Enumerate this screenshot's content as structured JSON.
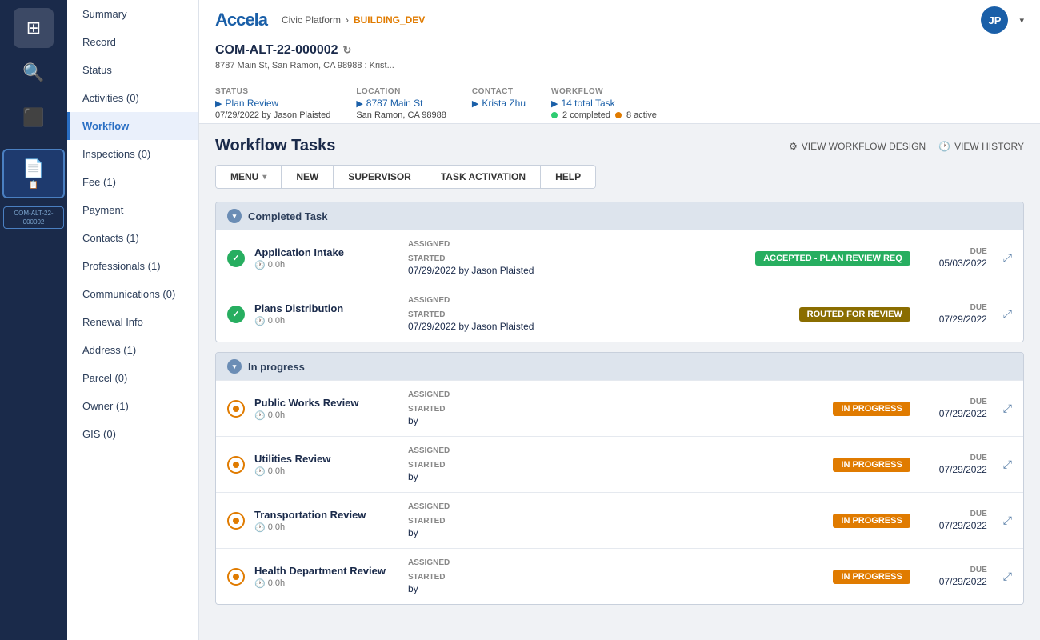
{
  "app": {
    "logo": "Accela",
    "breadcrumb": {
      "platform": "Civic Platform",
      "separator": "›",
      "env": "BUILDING_DEV"
    },
    "avatar": "JP",
    "chevron": "▾"
  },
  "record": {
    "id": "COM-ALT-22-000002",
    "address": "8787 Main St, San Ramon, CA 98988 : Krist...",
    "refresh_icon": "↻"
  },
  "meta_fields": [
    {
      "label": "STATUS",
      "value": "Plan Review",
      "sub": "07/29/2022 by Jason Plaisted",
      "has_arrow": true
    },
    {
      "label": "LOCATION",
      "value": "8787 Main St",
      "sub": "San Ramon, CA 98988",
      "has_arrow": true
    },
    {
      "label": "CONTACT",
      "value": "Krista Zhu",
      "sub": "",
      "has_arrow": true
    },
    {
      "label": "WORKFLOW",
      "value": "14 total Task",
      "sub_green": "2 completed",
      "sub_orange": "8 active",
      "has_arrow": true
    }
  ],
  "sidebar": {
    "items": [
      {
        "label": "Summary",
        "count": "",
        "active": false
      },
      {
        "label": "Record",
        "count": "",
        "active": false
      },
      {
        "label": "Status",
        "count": "",
        "active": false
      },
      {
        "label": "Activities",
        "count": "(0)",
        "active": false
      },
      {
        "label": "Workflow",
        "count": "",
        "active": true
      },
      {
        "label": "Inspections",
        "count": "(0)",
        "active": false
      },
      {
        "label": "Fee",
        "count": "(1)",
        "active": false
      },
      {
        "label": "Payment",
        "count": "",
        "active": false
      },
      {
        "label": "Contacts",
        "count": "(1)",
        "active": false
      },
      {
        "label": "Professionals",
        "count": "(1)",
        "active": false
      },
      {
        "label": "Communications",
        "count": "(0)",
        "active": false
      },
      {
        "label": "Renewal Info",
        "count": "",
        "active": false
      },
      {
        "label": "Address",
        "count": "(1)",
        "active": false
      },
      {
        "label": "Parcel",
        "count": "(0)",
        "active": false
      },
      {
        "label": "Owner",
        "count": "(1)",
        "active": false
      },
      {
        "label": "GIS",
        "count": "(0)",
        "active": false
      }
    ]
  },
  "workflow": {
    "title": "Workflow Tasks",
    "view_design_label": "VIEW WORKFLOW DESIGN",
    "view_history_label": "VIEW HISTORY",
    "toolbar": {
      "menu_label": "MENU",
      "new_label": "NEW",
      "supervisor_label": "SUPERVISOR",
      "task_activation_label": "TASK ACTIVATION",
      "help_label": "HELP"
    },
    "sections": [
      {
        "title": "Completed Task",
        "collapsed": false,
        "tasks": [
          {
            "name": "Application Intake",
            "time": "0.0h",
            "assigned_label": "ASSIGNED",
            "assigned_value": "",
            "started_label": "STARTED",
            "started_value": "07/29/2022 by Jason Plaisted",
            "badge": "ACCEPTED - PLAN REVIEW REQ",
            "badge_type": "accepted",
            "due_label": "DUE",
            "due_value": "05/03/2022",
            "status_type": "completed"
          },
          {
            "name": "Plans Distribution",
            "time": "0.0h",
            "assigned_label": "ASSIGNED",
            "assigned_value": "",
            "started_label": "STARTED",
            "started_value": "07/29/2022 by Jason Plaisted",
            "badge": "ROUTED FOR REVIEW",
            "badge_type": "routed",
            "due_label": "DUE",
            "due_value": "07/29/2022",
            "status_type": "completed"
          }
        ]
      },
      {
        "title": "In progress",
        "collapsed": false,
        "tasks": [
          {
            "name": "Public Works Review",
            "time": "0.0h",
            "assigned_label": "ASSIGNED",
            "assigned_value": "",
            "started_label": "STARTED",
            "started_value": "by",
            "badge": "IN PROGRESS",
            "badge_type": "inprogress",
            "due_label": "DUE",
            "due_value": "07/29/2022",
            "status_type": "inprogress"
          },
          {
            "name": "Utilities Review",
            "time": "0.0h",
            "assigned_label": "ASSIGNED",
            "assigned_value": "",
            "started_label": "STARTED",
            "started_value": "by",
            "badge": "IN PROGRESS",
            "badge_type": "inprogress",
            "due_label": "DUE",
            "due_value": "07/29/2022",
            "status_type": "inprogress"
          },
          {
            "name": "Transportation Review",
            "time": "0.0h",
            "assigned_label": "ASSIGNED",
            "assigned_value": "",
            "started_label": "STARTED",
            "started_value": "by",
            "badge": "IN PROGRESS",
            "badge_type": "inprogress",
            "due_label": "DUE",
            "due_value": "07/29/2022",
            "status_type": "inprogress"
          },
          {
            "name": "Health Department Review",
            "time": "0.0h",
            "assigned_label": "ASSIGNED",
            "assigned_value": "",
            "started_label": "STARTED",
            "started_value": "by",
            "badge": "IN PROGRESS",
            "badge_type": "inprogress",
            "due_label": "DUE",
            "due_value": "07/29/2022",
            "status_type": "inprogress"
          }
        ]
      }
    ]
  },
  "icons": {
    "grid": "⊞",
    "search": "🔍",
    "record": "📋",
    "clock": "🕐",
    "expand": "⤢",
    "design": "⚙",
    "history": "🕐",
    "chevron_down": "▾",
    "chevron_right": "›",
    "check": "✓"
  }
}
